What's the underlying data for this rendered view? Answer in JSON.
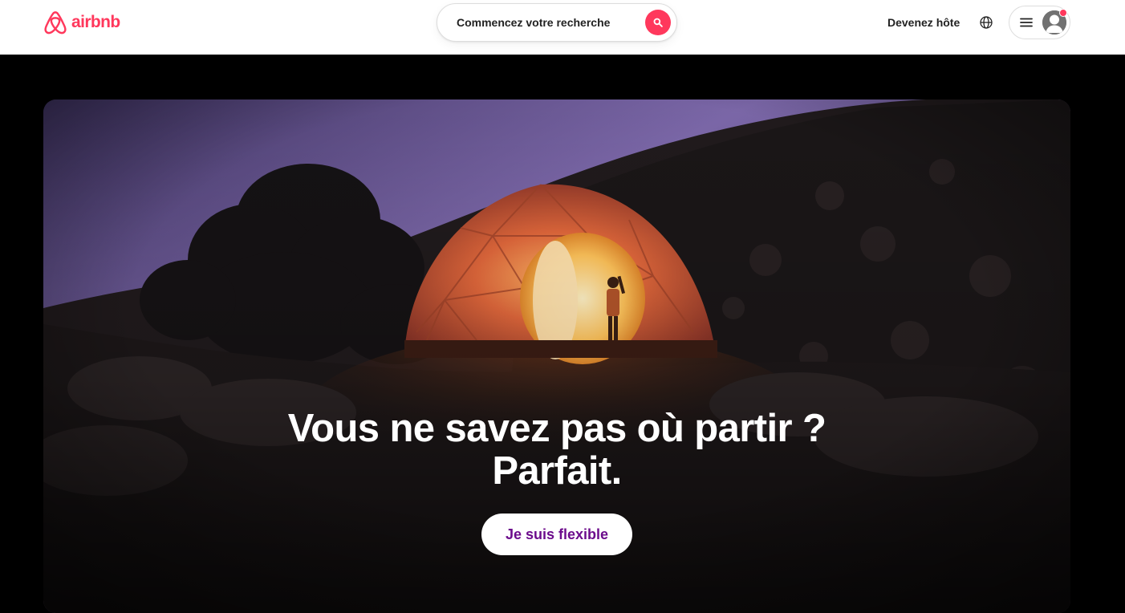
{
  "header": {
    "brand": "airbnb",
    "search_placeholder": "Commencez votre recherche",
    "host_link": "Devenez hôte",
    "icons": {
      "logo": "airbnb-belo-icon",
      "search": "search-icon",
      "globe": "globe-icon",
      "menu": "hamburger-icon",
      "avatar": "user-avatar-icon"
    }
  },
  "hero": {
    "title_line1": "Vous ne savez pas où partir ?",
    "title_line2": "Parfait.",
    "cta_label": "Je suis flexible"
  },
  "colors": {
    "brand": "#ff385c",
    "cta_text": "#6c0c8c",
    "header_bg": "#ffffff",
    "page_bg": "#000000"
  }
}
